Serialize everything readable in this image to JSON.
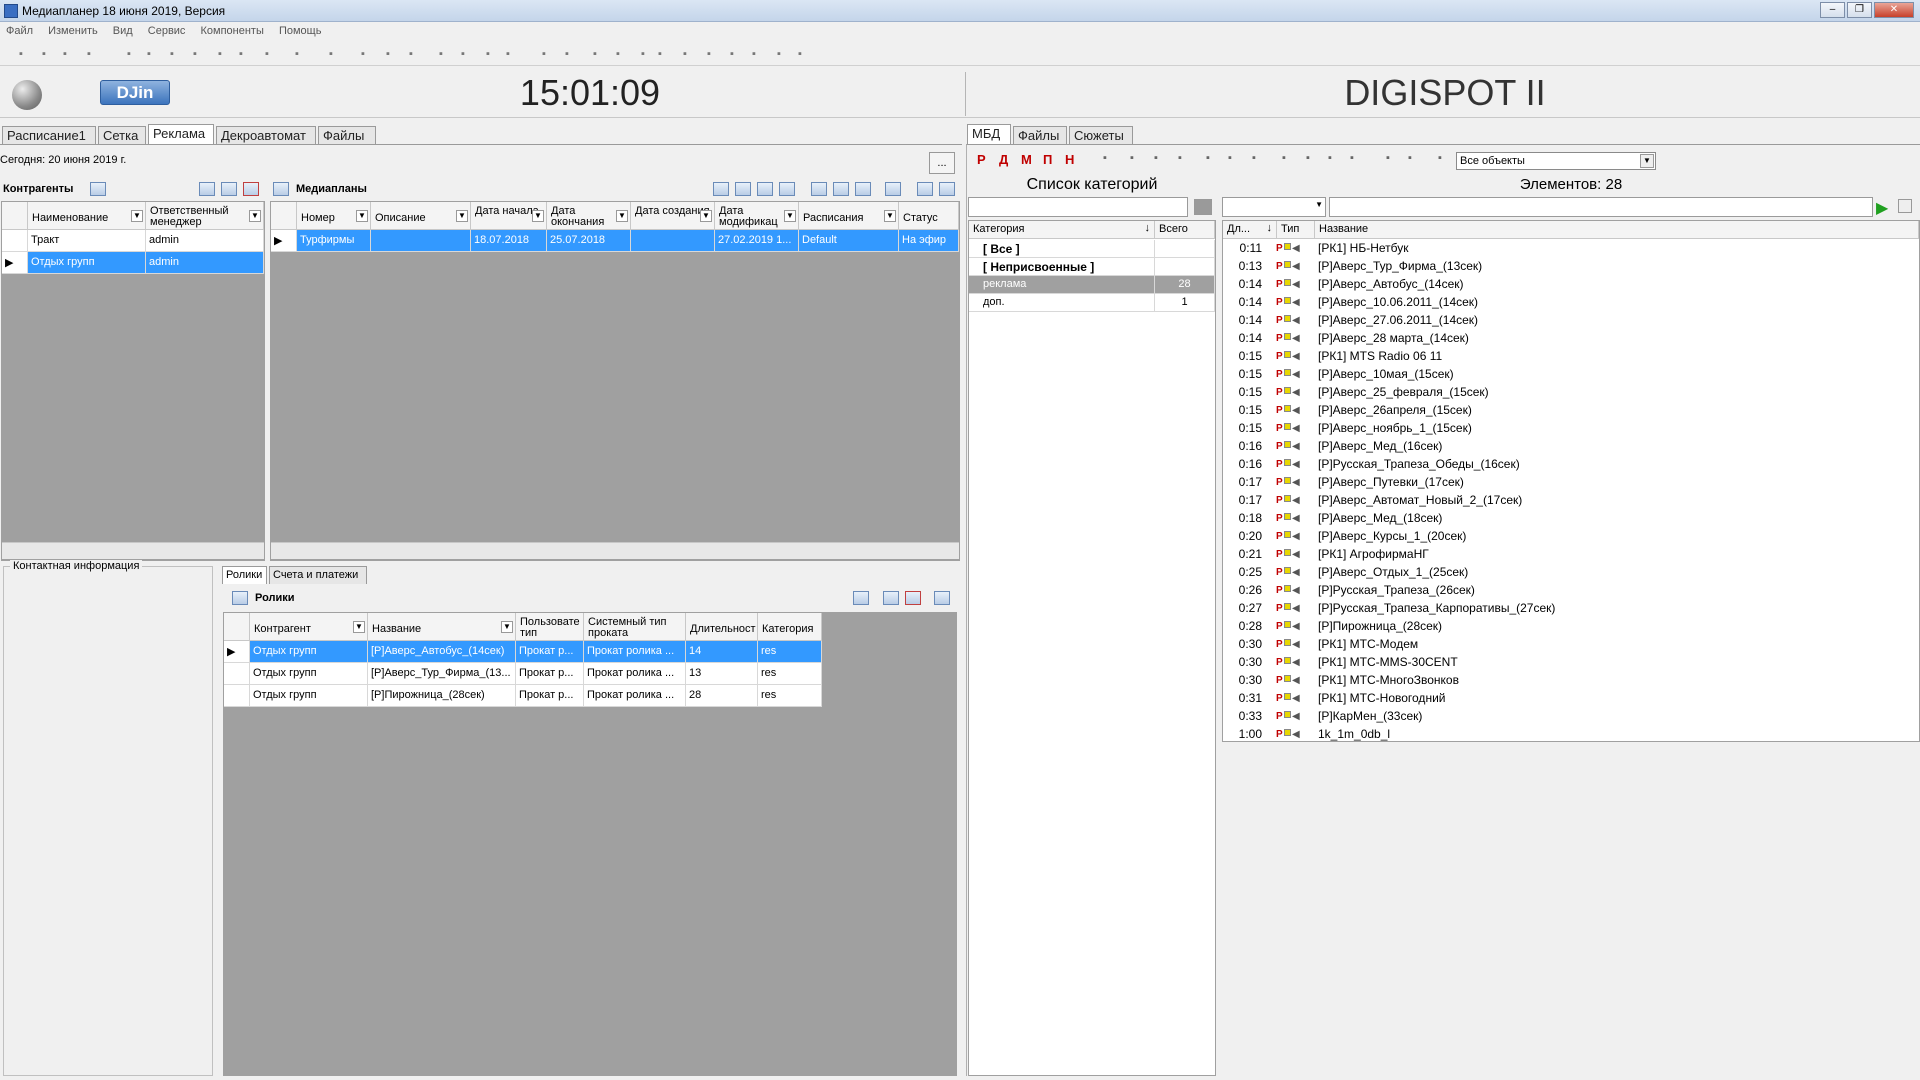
{
  "window": {
    "title": "Медиапланер 18 июня 2019, Версия",
    "min": "–",
    "max": "❐",
    "close": "✕"
  },
  "menu": [
    "Файл",
    "Изменить",
    "Вид",
    "Сервис",
    "Компоненты",
    "Помощь"
  ],
  "header": {
    "logo": "DJin",
    "clock": "15:01:09",
    "brand": "DIGISPOT II"
  },
  "left_tabs": [
    "Расписание1",
    "Сетка",
    "Реклама",
    "Декроавтомат",
    "Файлы"
  ],
  "today": "Сегодня: 20 июня 2019 г.",
  "more_button": "...",
  "counterparties": {
    "title": "Контрагенты",
    "columns": [
      "Наименование",
      "Ответственный менеджер"
    ],
    "rows": [
      {
        "name": "Тракт",
        "manager": "admin"
      },
      {
        "name": "Отдых групп",
        "manager": "admin"
      }
    ]
  },
  "mediaplans": {
    "title": "Медиапланы",
    "columns": [
      "Номер",
      "Описание",
      "Дата начала",
      "Дата окончания",
      "Дата создания",
      "Дата модификац",
      "Расписания",
      "Статус"
    ],
    "row": {
      "number": "Турфирмы",
      "desc": "",
      "start": "18.07.2018",
      "end": "25.07.2018",
      "created": "",
      "modified": "27.02.2019 1...",
      "schedule": "Default",
      "status": "На эфир"
    }
  },
  "contact_info": "Контактная информация",
  "sub_tabs": [
    "Ролики",
    "Счета и платежи"
  ],
  "spots": {
    "title": "Ролики",
    "columns": [
      "Контрагент",
      "Название",
      "Пользовате тип",
      "Системный тип проката",
      "Длительност",
      "Категория"
    ],
    "rows": [
      {
        "c": "Отдых групп",
        "n": "[Р]Аверс_Автобус_(14сек)",
        "u": "Прокат р...",
        "s": "Прокат ролика ...",
        "d": "14",
        "k": "res"
      },
      {
        "c": "Отдых групп",
        "n": "[Р]Аверс_Тур_Фирма_(13...",
        "u": "Прокат р...",
        "s": "Прокат ролика ...",
        "d": "13",
        "k": "res"
      },
      {
        "c": "Отдых групп",
        "n": "[Р]Пирожница_(28сек)",
        "u": "Прокат р...",
        "s": "Прокат ролика ...",
        "d": "28",
        "k": "res"
      }
    ]
  },
  "right_tabs": [
    "МБД",
    "Файлы",
    "Сюжеты"
  ],
  "objects_filter": "Все объекты",
  "categories": {
    "title": "Список категорий",
    "columns": [
      "Категория",
      "Всего"
    ],
    "rows": [
      {
        "name": "[ Все ]",
        "total": ""
      },
      {
        "name": "[ Неприсвоенные ]",
        "total": ""
      },
      {
        "name": "реклама",
        "total": "28"
      },
      {
        "name": "доп.",
        "total": "1"
      }
    ]
  },
  "elements": {
    "title": "Элементов: 28",
    "columns": [
      "Дл...",
      "Тип",
      "Название"
    ],
    "rows": [
      {
        "d": "0:11",
        "n": "[РК1] НБ-Нетбук"
      },
      {
        "d": "0:13",
        "n": "[Р]Аверс_Тур_Фирма_(13сек)"
      },
      {
        "d": "0:14",
        "n": "[Р]Аверс_Автобус_(14сек)"
      },
      {
        "d": "0:14",
        "n": "[Р]Аверс_10.06.2011_(14сек)"
      },
      {
        "d": "0:14",
        "n": "[Р]Аверс_27.06.2011_(14сек)"
      },
      {
        "d": "0:14",
        "n": "[Р]Аверс_28 марта_(14сек)"
      },
      {
        "d": "0:15",
        "n": "[РК1] MTS Radio 06 11"
      },
      {
        "d": "0:15",
        "n": "[Р]Аверс_10мая_(15сек)"
      },
      {
        "d": "0:15",
        "n": "[Р]Аверс_25_февраля_(15сек)"
      },
      {
        "d": "0:15",
        "n": "[Р]Аверс_26апреля_(15сек)"
      },
      {
        "d": "0:15",
        "n": "[Р]Аверс_ноябрь_1_(15сек)"
      },
      {
        "d": "0:16",
        "n": "[Р]Аверс_Мед_(16сек)"
      },
      {
        "d": "0:16",
        "n": "[Р]Русская_Трапеза_Обеды_(16сек)"
      },
      {
        "d": "0:17",
        "n": "[Р]Аверс_Путевки_(17сек)"
      },
      {
        "d": "0:17",
        "n": "[Р]Аверс_Автомат_Новый_2_(17сек)"
      },
      {
        "d": "0:18",
        "n": "[Р]Аверс_Мед_(18сек)"
      },
      {
        "d": "0:20",
        "n": "[Р]Аверс_Курсы_1_(20сек)"
      },
      {
        "d": "0:21",
        "n": "[РК1] АгрофирмаНГ"
      },
      {
        "d": "0:25",
        "n": "[Р]Аверс_Отдых_1_(25сек)"
      },
      {
        "d": "0:26",
        "n": "[Р]Русская_Трапеза_(26сек)"
      },
      {
        "d": "0:27",
        "n": "[Р]Русская_Трапеза_Карпоративы_(27сек)"
      },
      {
        "d": "0:28",
        "n": "[Р]Пирожница_(28сек)"
      },
      {
        "d": "0:30",
        "n": "[РК1] МТС-Модем"
      },
      {
        "d": "0:30",
        "n": "[РК1] МТС-MMS-30CENT"
      },
      {
        "d": "0:30",
        "n": "[РК1] МТС-МногоЗвонков"
      },
      {
        "d": "0:31",
        "n": "[РК1] МТС-Новогодний"
      },
      {
        "d": "0:33",
        "n": "[Р]КарМен_(33сек)"
      },
      {
        "d": "1:00",
        "n": "1k_1m_0db_l"
      }
    ]
  },
  "icons": {
    "play": "play-icon",
    "filter": "filter-icon",
    "table": "table-icon",
    "speaker": "speaker-icon"
  }
}
